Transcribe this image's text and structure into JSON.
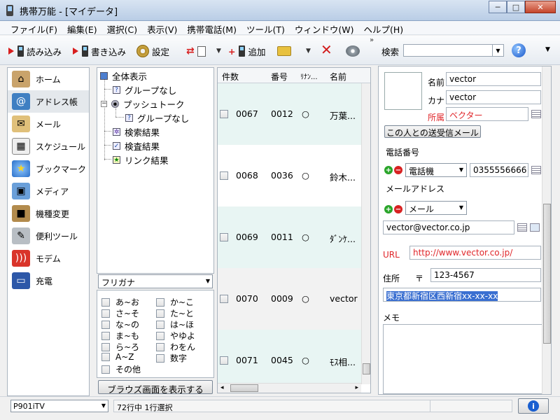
{
  "window": {
    "title": "携帯万能  - [マイデータ]",
    "minimize": "─",
    "maximize": "□",
    "close": "✕"
  },
  "menu": [
    "ファイル(F)",
    "編集(E)",
    "選択(C)",
    "表示(V)",
    "携帯電話(M)",
    "ツール(T)",
    "ウィンドウ(W)",
    "ヘルプ(H)"
  ],
  "toolbar": {
    "read": "読み込み",
    "write": "書き込み",
    "settings": "設定",
    "add": "追加",
    "search_label": "検索",
    "search_value": "",
    "more": "»"
  },
  "nav": [
    "ホーム",
    "アドレス帳",
    "メール",
    "スケジュール",
    "ブックマーク",
    "メディア",
    "機種変更",
    "便利ツール",
    "モデム",
    "充電"
  ],
  "nav_active": "アドレス帳",
  "tree": {
    "all": "全体表示",
    "no_group_1": "グループなし",
    "push_talk": "プッシュトーク",
    "no_group_2": "グループなし",
    "search_result": "検索結果",
    "inspect_result": "検査結果",
    "link_result": "リンク結果"
  },
  "kana_filter": {
    "selected": "フリガナ",
    "items": [
      "あ~お",
      "か~こ",
      "さ~そ",
      "た~と",
      "な~の",
      "は~ほ",
      "ま~も",
      "やゆよ",
      "ら~ろ",
      "わをん",
      "A~Z",
      "数字",
      "その他"
    ]
  },
  "browse_button": "ブラウズ画面を表示する",
  "list": {
    "headers": [
      "件数",
      "番号",
      "ﾘﾅﾝ...",
      "名前"
    ],
    "rows": [
      {
        "count": "0067",
        "number": "0012",
        "mark": "○",
        "name": "万葉..."
      },
      {
        "count": "0068",
        "number": "0036",
        "mark": "○",
        "name": "鈴木..."
      },
      {
        "count": "0069",
        "number": "0011",
        "mark": "○",
        "name": "ﾀﾞﾝｹ..."
      },
      {
        "count": "0070",
        "number": "0009",
        "mark": "○",
        "name": "vector"
      },
      {
        "count": "0071",
        "number": "0045",
        "mark": "○",
        "name": "ﾓｽ相..."
      }
    ]
  },
  "detail": {
    "name_label": "名前",
    "name": "vector",
    "kana_label": "カナ",
    "kana": "vector",
    "affil_label": "所属",
    "affil": "ベクター",
    "mail_button": "この人との送受信メール",
    "phone_label": "電話番号",
    "phone_type": "電話機",
    "phone": "0355556666",
    "email_label": "メールアドレス",
    "email_type": "メール",
    "email": "vector@vector.co.jp",
    "url_label": "URL",
    "url": "http://www.vector.co.jp/",
    "address_label": "住所",
    "postal_mark": "〒",
    "postal": "123-4567",
    "address": "東京都新宿区西新宿xx-xx-xx",
    "memo_label": "メモ",
    "plus": "+",
    "minus": "−"
  },
  "status": {
    "device": "P901iTV",
    "text": "72行中 1行選択",
    "info": "i"
  },
  "colors": {
    "accent_red": "#d81e1e",
    "url_red": "#e0262a",
    "selection": "#3a6fd1",
    "row_alt": "#e8f5f3"
  }
}
